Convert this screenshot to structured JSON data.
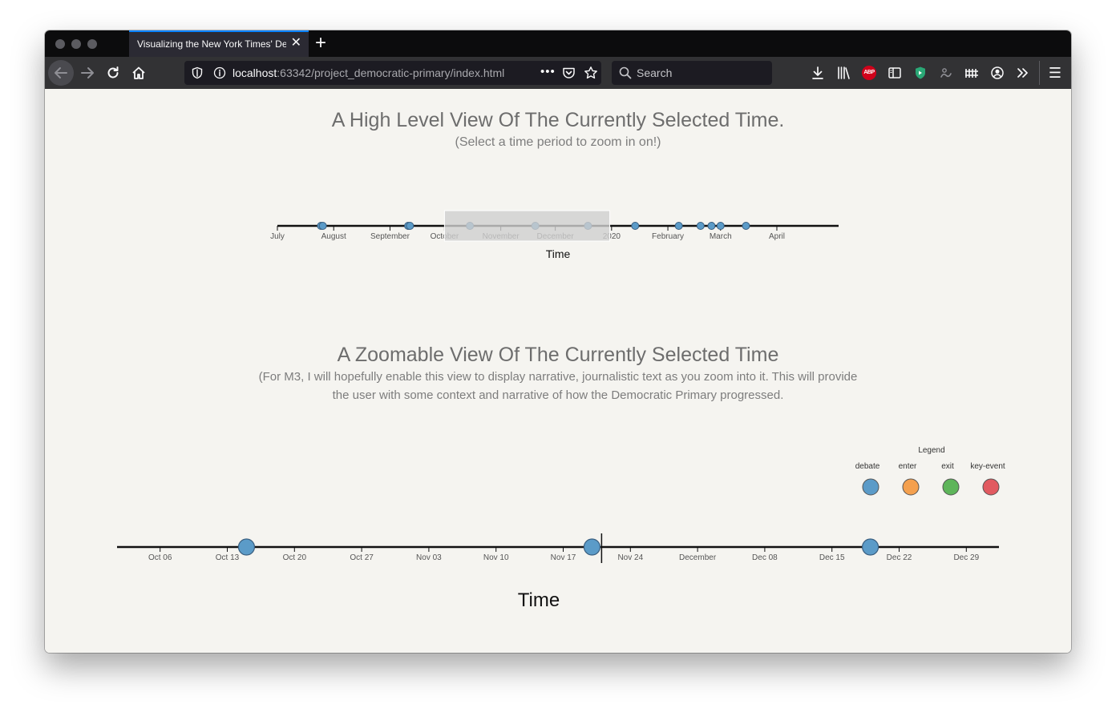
{
  "browser": {
    "tab_title": "Visualizing the New York Times' Democratic Primary",
    "new_tab_label": "+",
    "url_host": "localhost",
    "url_path": ":63342/project_democratic-primary/index.html",
    "search_placeholder": "Search",
    "page_actions_label": "•••",
    "menu_label": "☰",
    "abp_label": "ABP"
  },
  "overview": {
    "title": "A High Level View Of The Currently Selected Time.",
    "subtitle": "(Select a time period to zoom in on!)"
  },
  "zoom": {
    "title": "A Zoomable View Of The Currently Selected Time",
    "description": "(For M3, I will hopefully enable this view to display narrative, journalistic text as you zoom into it. This will provide the user with some context and narrative of how the Democratic Primary progressed."
  },
  "colors": {
    "debate": "#5b9bc8",
    "enter": "#f4a04e",
    "exit": "#5eb55a",
    "key_event": "#e15a60",
    "brush": "#cfcfcf"
  },
  "chart_data": [
    {
      "type": "scatter",
      "name": "overview-timeline",
      "xlabel": "Time",
      "ticks": [
        "July",
        "August",
        "September",
        "October",
        "November",
        "December",
        "2020",
        "February",
        "March",
        "April"
      ],
      "x_range": [
        "2019-07-01",
        "2020-05-05"
      ],
      "events": [
        {
          "date": "2019-07-25",
          "category": "debate"
        },
        {
          "date": "2019-07-26",
          "category": "debate"
        },
        {
          "date": "2019-09-11",
          "category": "debate"
        },
        {
          "date": "2019-09-12",
          "category": "debate"
        },
        {
          "date": "2019-10-15",
          "category": "debate"
        },
        {
          "date": "2019-11-20",
          "category": "debate"
        },
        {
          "date": "2019-12-19",
          "category": "debate"
        },
        {
          "date": "2020-01-14",
          "category": "debate"
        },
        {
          "date": "2020-02-07",
          "category": "debate"
        },
        {
          "date": "2020-02-19",
          "category": "debate"
        },
        {
          "date": "2020-02-25",
          "category": "debate"
        },
        {
          "date": "2020-03-01",
          "category": "debate"
        },
        {
          "date": "2020-03-15",
          "category": "debate"
        }
      ],
      "selection": [
        "2019-10-01",
        "2019-12-31"
      ]
    },
    {
      "type": "scatter",
      "name": "zoom-timeline",
      "xlabel": "Time",
      "ticks": [
        "Oct 06",
        "Oct 13",
        "Oct 20",
        "Oct 27",
        "Nov 03",
        "Nov 10",
        "Nov 17",
        "Nov 24",
        "December",
        "Dec 08",
        "Dec 15",
        "Dec 22",
        "Dec 29"
      ],
      "x_range": [
        "2019-10-01",
        "2019-12-31"
      ],
      "events": [
        {
          "date": "2019-10-15",
          "category": "debate"
        },
        {
          "date": "2019-11-20",
          "category": "debate"
        },
        {
          "date": "2019-12-19",
          "category": "debate"
        }
      ],
      "marker_date": "2019-11-21",
      "legend": {
        "title": "Legend",
        "items": [
          {
            "label": "debate",
            "color": "#5b9bc8"
          },
          {
            "label": "enter",
            "color": "#f4a04e"
          },
          {
            "label": "exit",
            "color": "#5eb55a"
          },
          {
            "label": "key-event",
            "color": "#e15a60"
          }
        ]
      }
    }
  ]
}
